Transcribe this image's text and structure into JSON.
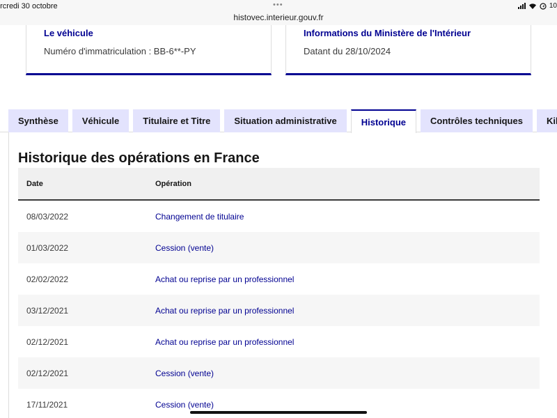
{
  "statusbar": {
    "date": "ercredi 30 octobre",
    "url": "histovec.interieur.gouv.fr",
    "battery_partial": "10"
  },
  "cards": {
    "vehicle": {
      "title": "Le véhicule",
      "text": "Numéro d'immatriculation : BB-6**-PY"
    },
    "ministry": {
      "title": "Informations du Ministère de l'Intérieur",
      "text": "Datant du 28/10/2024"
    }
  },
  "tabs": [
    {
      "label": "Synthèse",
      "active": false
    },
    {
      "label": "Véhicule",
      "active": false
    },
    {
      "label": "Titulaire et Titre",
      "active": false
    },
    {
      "label": "Situation administrative",
      "active": false
    },
    {
      "label": "Historique",
      "active": true
    },
    {
      "label": "Contrôles techniques",
      "active": false
    },
    {
      "label": "Kil",
      "active": false
    }
  ],
  "section": {
    "title": "Historique des opérations en France"
  },
  "table": {
    "headers": {
      "date": "Date",
      "operation": "Opération"
    },
    "rows": [
      {
        "date": "08/03/2022",
        "operation": "Changement de titulaire"
      },
      {
        "date": "01/03/2022",
        "operation": "Cession (vente)"
      },
      {
        "date": "02/02/2022",
        "operation": "Achat ou reprise par un professionnel"
      },
      {
        "date": "03/12/2021",
        "operation": "Achat ou reprise par un professionnel"
      },
      {
        "date": "02/12/2021",
        "operation": "Achat ou reprise par un professionnel"
      },
      {
        "date": "02/12/2021",
        "operation": "Cession (vente)"
      },
      {
        "date": "17/11/2021",
        "operation": "Cession (vente)"
      }
    ]
  },
  "colors": {
    "accent": "#000091",
    "tab_background": "#e3e3fd",
    "table_header_background": "#f0f0f0"
  },
  "icons": [
    "signal-icon",
    "wifi-icon",
    "location-icon",
    "more-dots-icon"
  ]
}
